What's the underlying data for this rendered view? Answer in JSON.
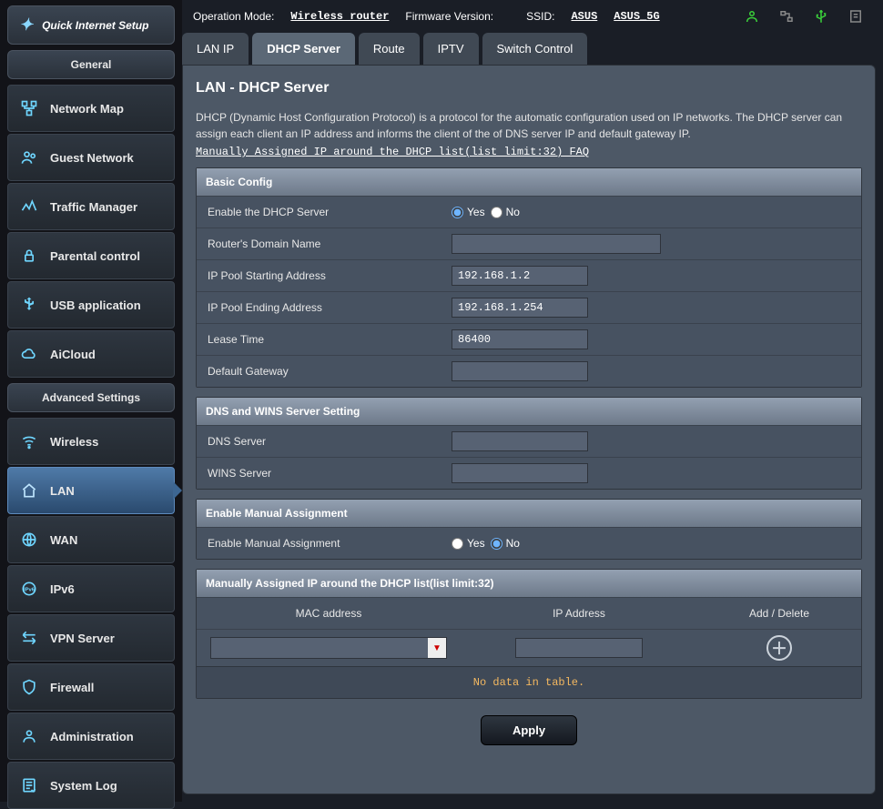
{
  "topbar": {
    "op_mode_label": "Operation Mode:",
    "op_mode_value": "Wireless router",
    "fw_label": "Firmware Version:",
    "fw_value": "",
    "ssid_label": "SSID:",
    "ssid_values": [
      "ASUS",
      "ASUS_5G"
    ]
  },
  "sidebar": {
    "quick_setup_label": "Quick Internet Setup",
    "general_title": "General",
    "advanced_title": "Advanced Settings",
    "general_items": [
      {
        "label": "Network Map"
      },
      {
        "label": "Guest Network"
      },
      {
        "label": "Traffic Manager"
      },
      {
        "label": "Parental control"
      },
      {
        "label": "USB application"
      },
      {
        "label": "AiCloud"
      }
    ],
    "advanced_items": [
      {
        "label": "Wireless"
      },
      {
        "label": "LAN"
      },
      {
        "label": "WAN"
      },
      {
        "label": "IPv6"
      },
      {
        "label": "VPN Server"
      },
      {
        "label": "Firewall"
      },
      {
        "label": "Administration"
      },
      {
        "label": "System Log"
      }
    ]
  },
  "tabs": [
    {
      "label": "LAN IP"
    },
    {
      "label": "DHCP Server"
    },
    {
      "label": "Route"
    },
    {
      "label": "IPTV"
    },
    {
      "label": "Switch Control"
    }
  ],
  "page": {
    "title": "LAN - DHCP Server",
    "description": "DHCP (Dynamic Host Configuration Protocol) is a protocol for the automatic configuration used on IP networks. The DHCP server can assign each client an IP address and informs the client of the of DNS server IP and default gateway IP.",
    "faq_link": "Manually Assigned IP around the DHCP list(list limit:32) FAQ",
    "basic": {
      "header": "Basic Config",
      "enable_label": "Enable the DHCP Server",
      "enable_value": "Yes",
      "yes": "Yes",
      "no": "No",
      "domain_label": "Router's Domain Name",
      "domain_value": "",
      "pool_start_label": "IP Pool Starting Address",
      "pool_start_value": "192.168.1.2",
      "pool_end_label": "IP Pool Ending Address",
      "pool_end_value": "192.168.1.254",
      "lease_label": "Lease Time",
      "lease_value": "86400",
      "gateway_label": "Default Gateway",
      "gateway_value": ""
    },
    "dnswins": {
      "header": "DNS and WINS Server Setting",
      "dns_label": "DNS Server",
      "dns_value": "",
      "wins_label": "WINS Server",
      "wins_value": ""
    },
    "manual": {
      "header": "Enable Manual Assignment",
      "enable_label": "Enable Manual Assignment",
      "enable_value": "No",
      "yes": "Yes",
      "no": "No"
    },
    "assign_table": {
      "header": "Manually Assigned IP around the DHCP list(list limit:32)",
      "col_mac": "MAC address",
      "col_ip": "IP Address",
      "col_action": "Add / Delete",
      "empty": "No data in table."
    },
    "apply_label": "Apply"
  }
}
